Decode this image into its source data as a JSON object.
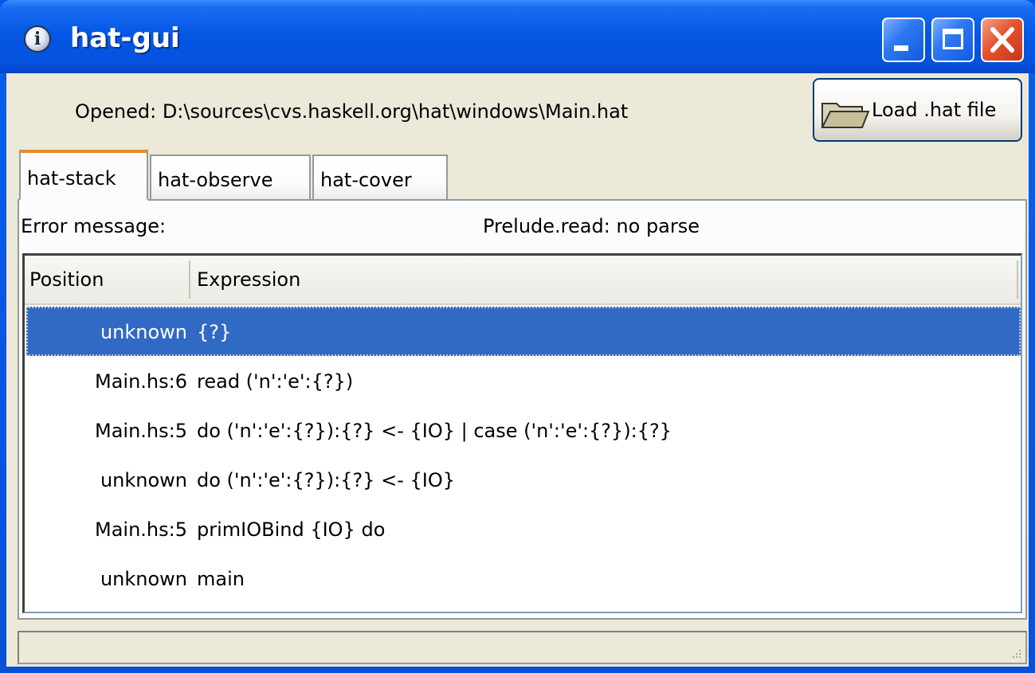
{
  "window": {
    "title": "hat-gui",
    "icon": "info-icon"
  },
  "header": {
    "opened_text": "Opened: D:\\sources\\cvs.haskell.org\\hat\\windows\\Main.hat",
    "load_button_label": "Load .hat file",
    "load_button_icon": "folder-icon"
  },
  "tabs": [
    {
      "label": "hat-stack",
      "active": true
    },
    {
      "label": "hat-observe",
      "active": false
    },
    {
      "label": "hat-cover",
      "active": false
    }
  ],
  "error": {
    "label": "Error message:",
    "value": "Prelude.read: no parse"
  },
  "table": {
    "columns": [
      "Position",
      "Expression"
    ],
    "rows": [
      {
        "position": "unknown",
        "expression": "{?}",
        "selected": true
      },
      {
        "position": "Main.hs:6",
        "expression": "read ('n':'e':{?})",
        "selected": false
      },
      {
        "position": "Main.hs:5",
        "expression": "do ('n':'e':{?}):{?} <- {IO} | case ('n':'e':{?}):{?}",
        "selected": false
      },
      {
        "position": "unknown",
        "expression": "do ('n':'e':{?}):{?} <- {IO}",
        "selected": false
      },
      {
        "position": "Main.hs:5",
        "expression": "primIOBind {IO} do",
        "selected": false
      },
      {
        "position": "unknown",
        "expression": "main",
        "selected": false
      }
    ]
  },
  "colors": {
    "selection": "#316ac5",
    "titlebar": "#0458e4",
    "face": "#ece9d8"
  }
}
